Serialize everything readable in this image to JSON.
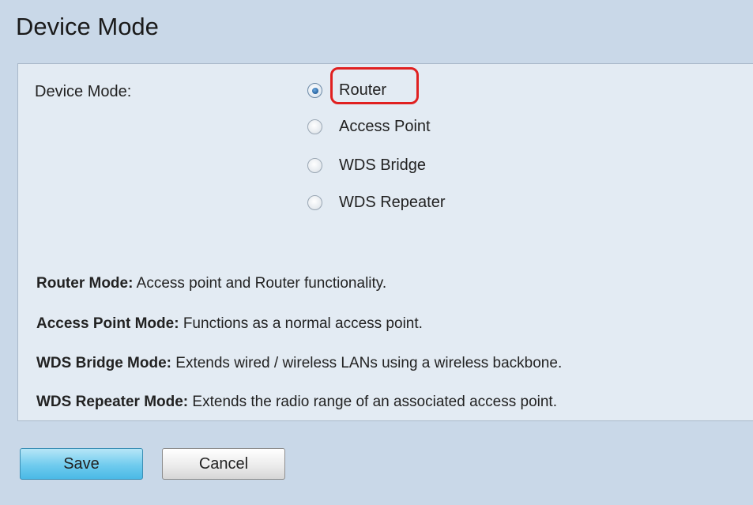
{
  "page": {
    "title": "Device Mode"
  },
  "form": {
    "device_mode_label": "Device Mode:",
    "options": [
      {
        "label": "Router",
        "checked": true
      },
      {
        "label": "Access Point",
        "checked": false
      },
      {
        "label": "WDS Bridge",
        "checked": false
      },
      {
        "label": "WDS Repeater",
        "checked": false
      }
    ]
  },
  "descriptions": [
    {
      "term": "Router Mode:",
      "text": " Access point and Router functionality."
    },
    {
      "term": "Access Point Mode:",
      "text": " Functions as a normal access point."
    },
    {
      "term": "WDS Bridge Mode:",
      "text": " Extends wired / wireless LANs using a wireless backbone."
    },
    {
      "term": "WDS Repeater Mode:",
      "text": " Extends the radio range of an associated access point."
    }
  ],
  "buttons": {
    "save": "Save",
    "cancel": "Cancel"
  },
  "colors": {
    "highlight": "#e02020",
    "save_button": "#6fcbee",
    "page_bg": "#c9d8e8",
    "panel_bg": "#e3ebf3"
  }
}
